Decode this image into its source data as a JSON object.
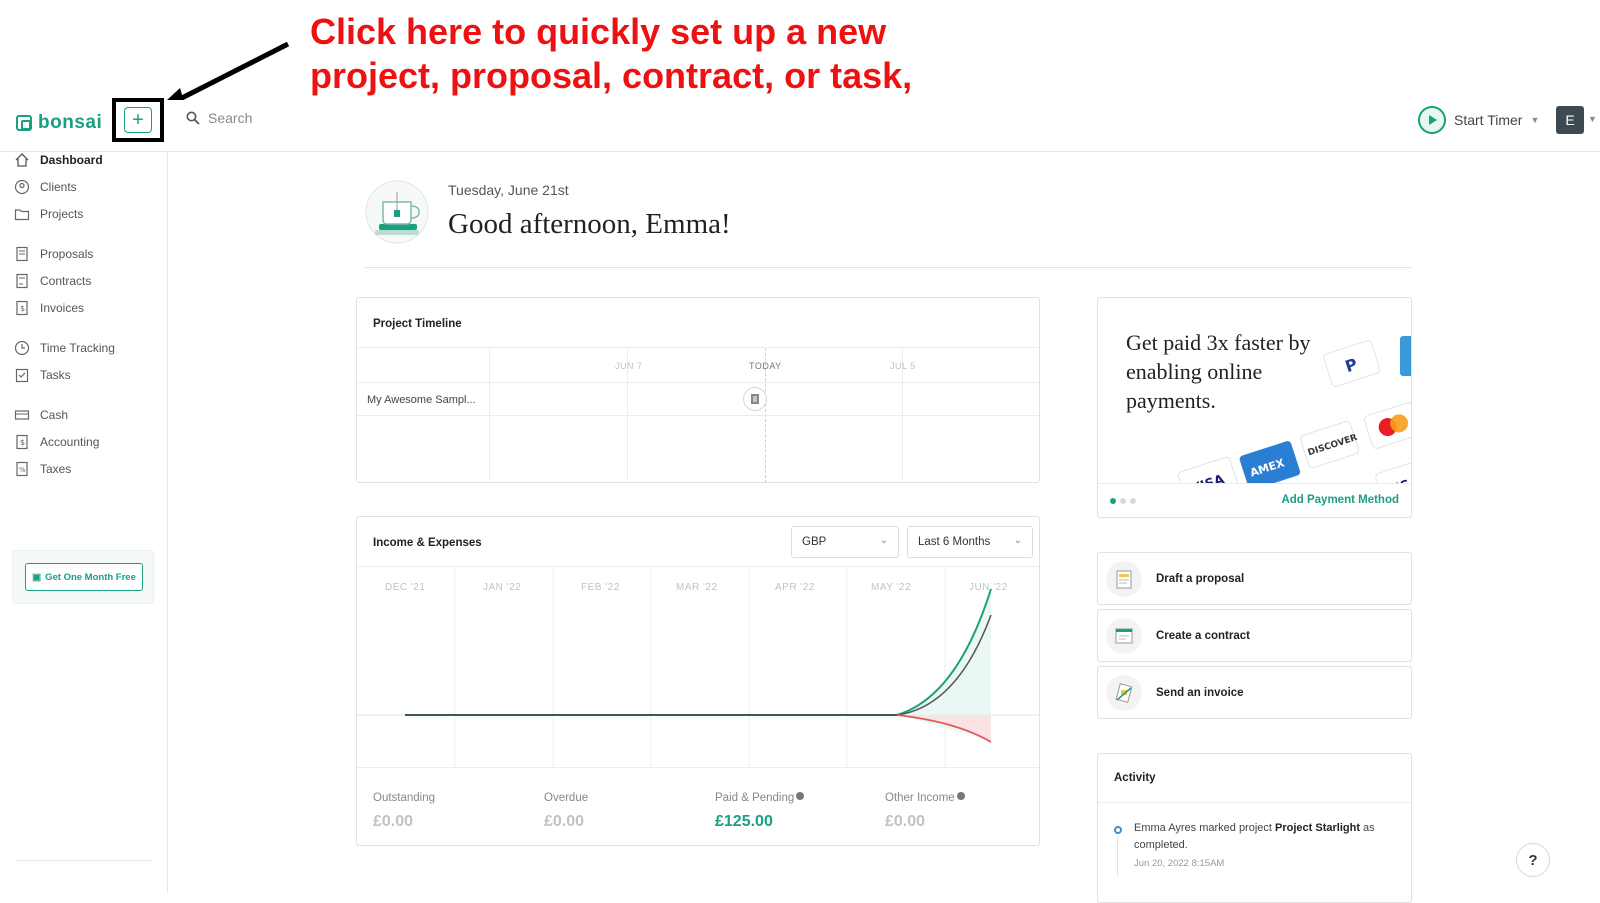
{
  "annotation": {
    "text": "Click here to quickly set up a new project, proposal, contract, or task, or add new transactions"
  },
  "header": {
    "brand": "bonsai",
    "add_button": "+",
    "search_placeholder": "Search",
    "timer_label": "Start Timer",
    "avatar_initial": "E"
  },
  "sidebar": {
    "items": [
      {
        "label": "Dashboard",
        "icon": "home-icon"
      },
      {
        "label": "Clients",
        "icon": "clients-icon"
      },
      {
        "label": "Projects",
        "icon": "folder-icon"
      },
      {
        "label": "Proposals",
        "icon": "proposal-icon"
      },
      {
        "label": "Contracts",
        "icon": "contract-icon"
      },
      {
        "label": "Invoices",
        "icon": "invoice-icon"
      },
      {
        "label": "Time Tracking",
        "icon": "clock-icon"
      },
      {
        "label": "Tasks",
        "icon": "tasks-icon"
      },
      {
        "label": "Cash",
        "icon": "cash-icon"
      },
      {
        "label": "Accounting",
        "icon": "accounting-icon"
      },
      {
        "label": "Taxes",
        "icon": "taxes-icon"
      }
    ],
    "promo_button": "Get One Month Free"
  },
  "greeting": {
    "date": "Tuesday, June 21st",
    "message": "Good afternoon, Emma!"
  },
  "timeline": {
    "title": "Project Timeline",
    "labels": [
      "JUN 7",
      "TODAY",
      "JUL 5"
    ],
    "project": "My Awesome Sampl..."
  },
  "income": {
    "title": "Income & Expenses",
    "currency": "GBP",
    "period": "Last 6 Months",
    "months": [
      "DEC '21",
      "JAN '22",
      "FEB '22",
      "MAR '22",
      "APR '22",
      "MAY '22",
      "JUN '22"
    ],
    "stats": [
      {
        "label": "Outstanding",
        "value": "£0.00"
      },
      {
        "label": "Overdue",
        "value": "£0.00"
      },
      {
        "label": "Paid & Pending",
        "value": "£125.00"
      },
      {
        "label": "Other Income",
        "value": "£0.00"
      }
    ]
  },
  "payments_promo": {
    "text": "Get paid 3x faster by enabling online payments.",
    "link": "Add Payment Method",
    "cards": [
      "VISA",
      "AMEX",
      "DISCOVER",
      "VISA"
    ]
  },
  "actions": [
    {
      "label": "Draft a proposal"
    },
    {
      "label": "Create a contract"
    },
    {
      "label": "Send an invoice"
    }
  ],
  "activity": {
    "title": "Activity",
    "entry_prefix": "Emma Ayres marked project ",
    "entry_project": "Project Starlight",
    "entry_suffix": " as completed.",
    "entry_time": "Jun 20, 2022 8:15AM"
  },
  "help_label": "?",
  "colors": {
    "accent": "#1a9f80",
    "annotation": "#ee1111",
    "expense": "#e05a5a"
  }
}
